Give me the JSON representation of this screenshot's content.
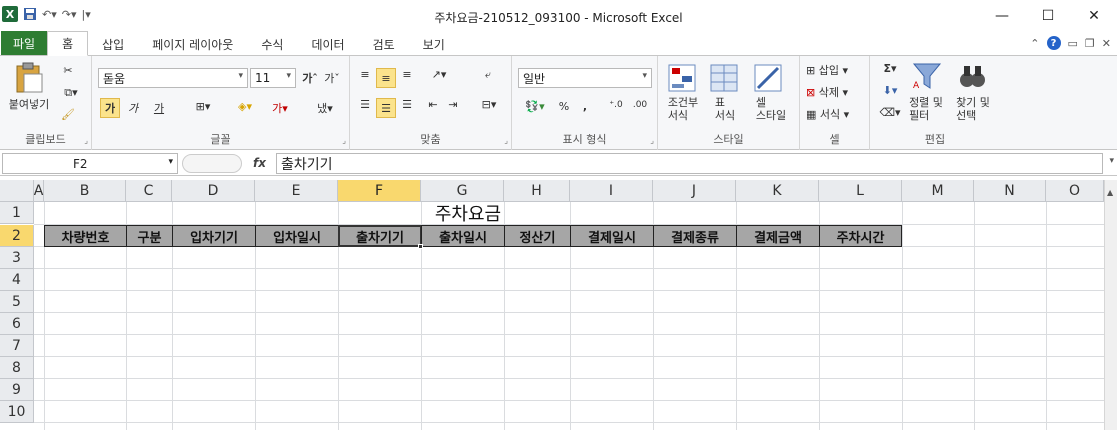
{
  "window": {
    "title": "주차요금-210512_093100  -  Microsoft Excel",
    "qat_icons": [
      "excel-icon",
      "save-icon",
      "undo-icon",
      "redo-icon",
      "customize-icon"
    ],
    "controls": {
      "minimize": "—",
      "maximize": "☐",
      "close": "✕"
    }
  },
  "tabs": [
    {
      "label": "파일",
      "key": "file"
    },
    {
      "label": "홈",
      "key": "home",
      "active": true
    },
    {
      "label": "삽입",
      "key": "insert"
    },
    {
      "label": "페이지 레이아웃",
      "key": "page-layout"
    },
    {
      "label": "수식",
      "key": "formulas"
    },
    {
      "label": "데이터",
      "key": "data"
    },
    {
      "label": "검토",
      "key": "review"
    },
    {
      "label": "보기",
      "key": "view"
    }
  ],
  "ribbon": {
    "clipboard": {
      "label": "클립보드",
      "paste": "붙여넣기"
    },
    "font": {
      "label": "글꼴",
      "name": "돋움",
      "size": "11",
      "bold": "가",
      "italic": "가",
      "underline": "가"
    },
    "alignment": {
      "label": "맞춤"
    },
    "number": {
      "label": "표시 형식",
      "format": "일반",
      "percent": "%",
      "comma": ","
    },
    "styles": {
      "label": "스타일",
      "conditional": "조건부\n서식",
      "table": "표\n서식",
      "cell": "셀\n스타일"
    },
    "cells": {
      "label": "셀",
      "insert": "삽입",
      "delete": "삭제",
      "format": "서식"
    },
    "editing": {
      "label": "편집",
      "sort": "정렬 및\n필터",
      "find": "찾기 및\n선택"
    }
  },
  "formula_bar": {
    "name_box": "F2",
    "fx": "fx",
    "value": "출차기기"
  },
  "sheet": {
    "columns": [
      "A",
      "B",
      "C",
      "D",
      "E",
      "F",
      "G",
      "H",
      "I",
      "J",
      "K",
      "L",
      "M",
      "N",
      "O"
    ],
    "rows": [
      "1",
      "2",
      "3",
      "4",
      "5",
      "6",
      "7",
      "8",
      "9",
      "10"
    ],
    "active_cell": "F2",
    "title": "주차요금",
    "headers": [
      "차량번호",
      "구분",
      "입차기기",
      "입차일시",
      "출차기기",
      "출차일시",
      "정산기",
      "결제일시",
      "결제종류",
      "결제금액",
      "주차시간"
    ]
  },
  "colors": {
    "file_tab": "#2e7d32",
    "header_fill": "#a6a6a6",
    "selection": "#f9d86e"
  }
}
